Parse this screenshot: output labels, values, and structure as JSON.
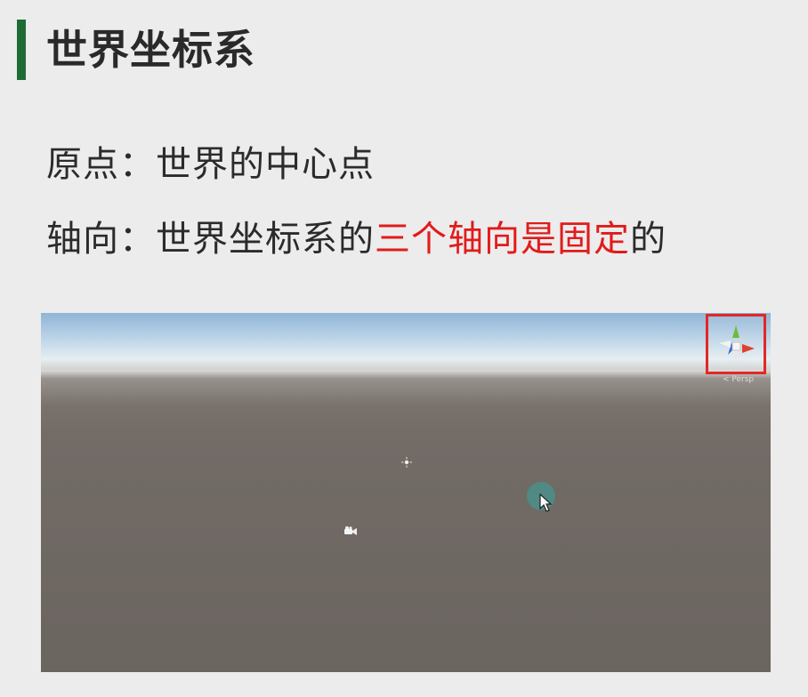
{
  "slide": {
    "title": "世界坐标系",
    "line1": {
      "label": "原点：",
      "text": "世界的中心点"
    },
    "line2": {
      "label": "轴向：",
      "text_before": "世界坐标系的",
      "highlight": "三个轴向是固定",
      "text_after": "的"
    }
  },
  "scene_view": {
    "persp_label": "< Persp",
    "gizmo_axes": [
      "y",
      "x",
      "z"
    ]
  },
  "colors": {
    "title_bar": "#1f6b36",
    "highlight": "#e21b1b",
    "gizmo_frame": "#e32727",
    "ground": "#6b6560",
    "sky": "#8fb5d6"
  },
  "icons": [
    "light-icon",
    "camera-icon",
    "scene-gizmo-icon",
    "mouse-cursor-icon"
  ]
}
